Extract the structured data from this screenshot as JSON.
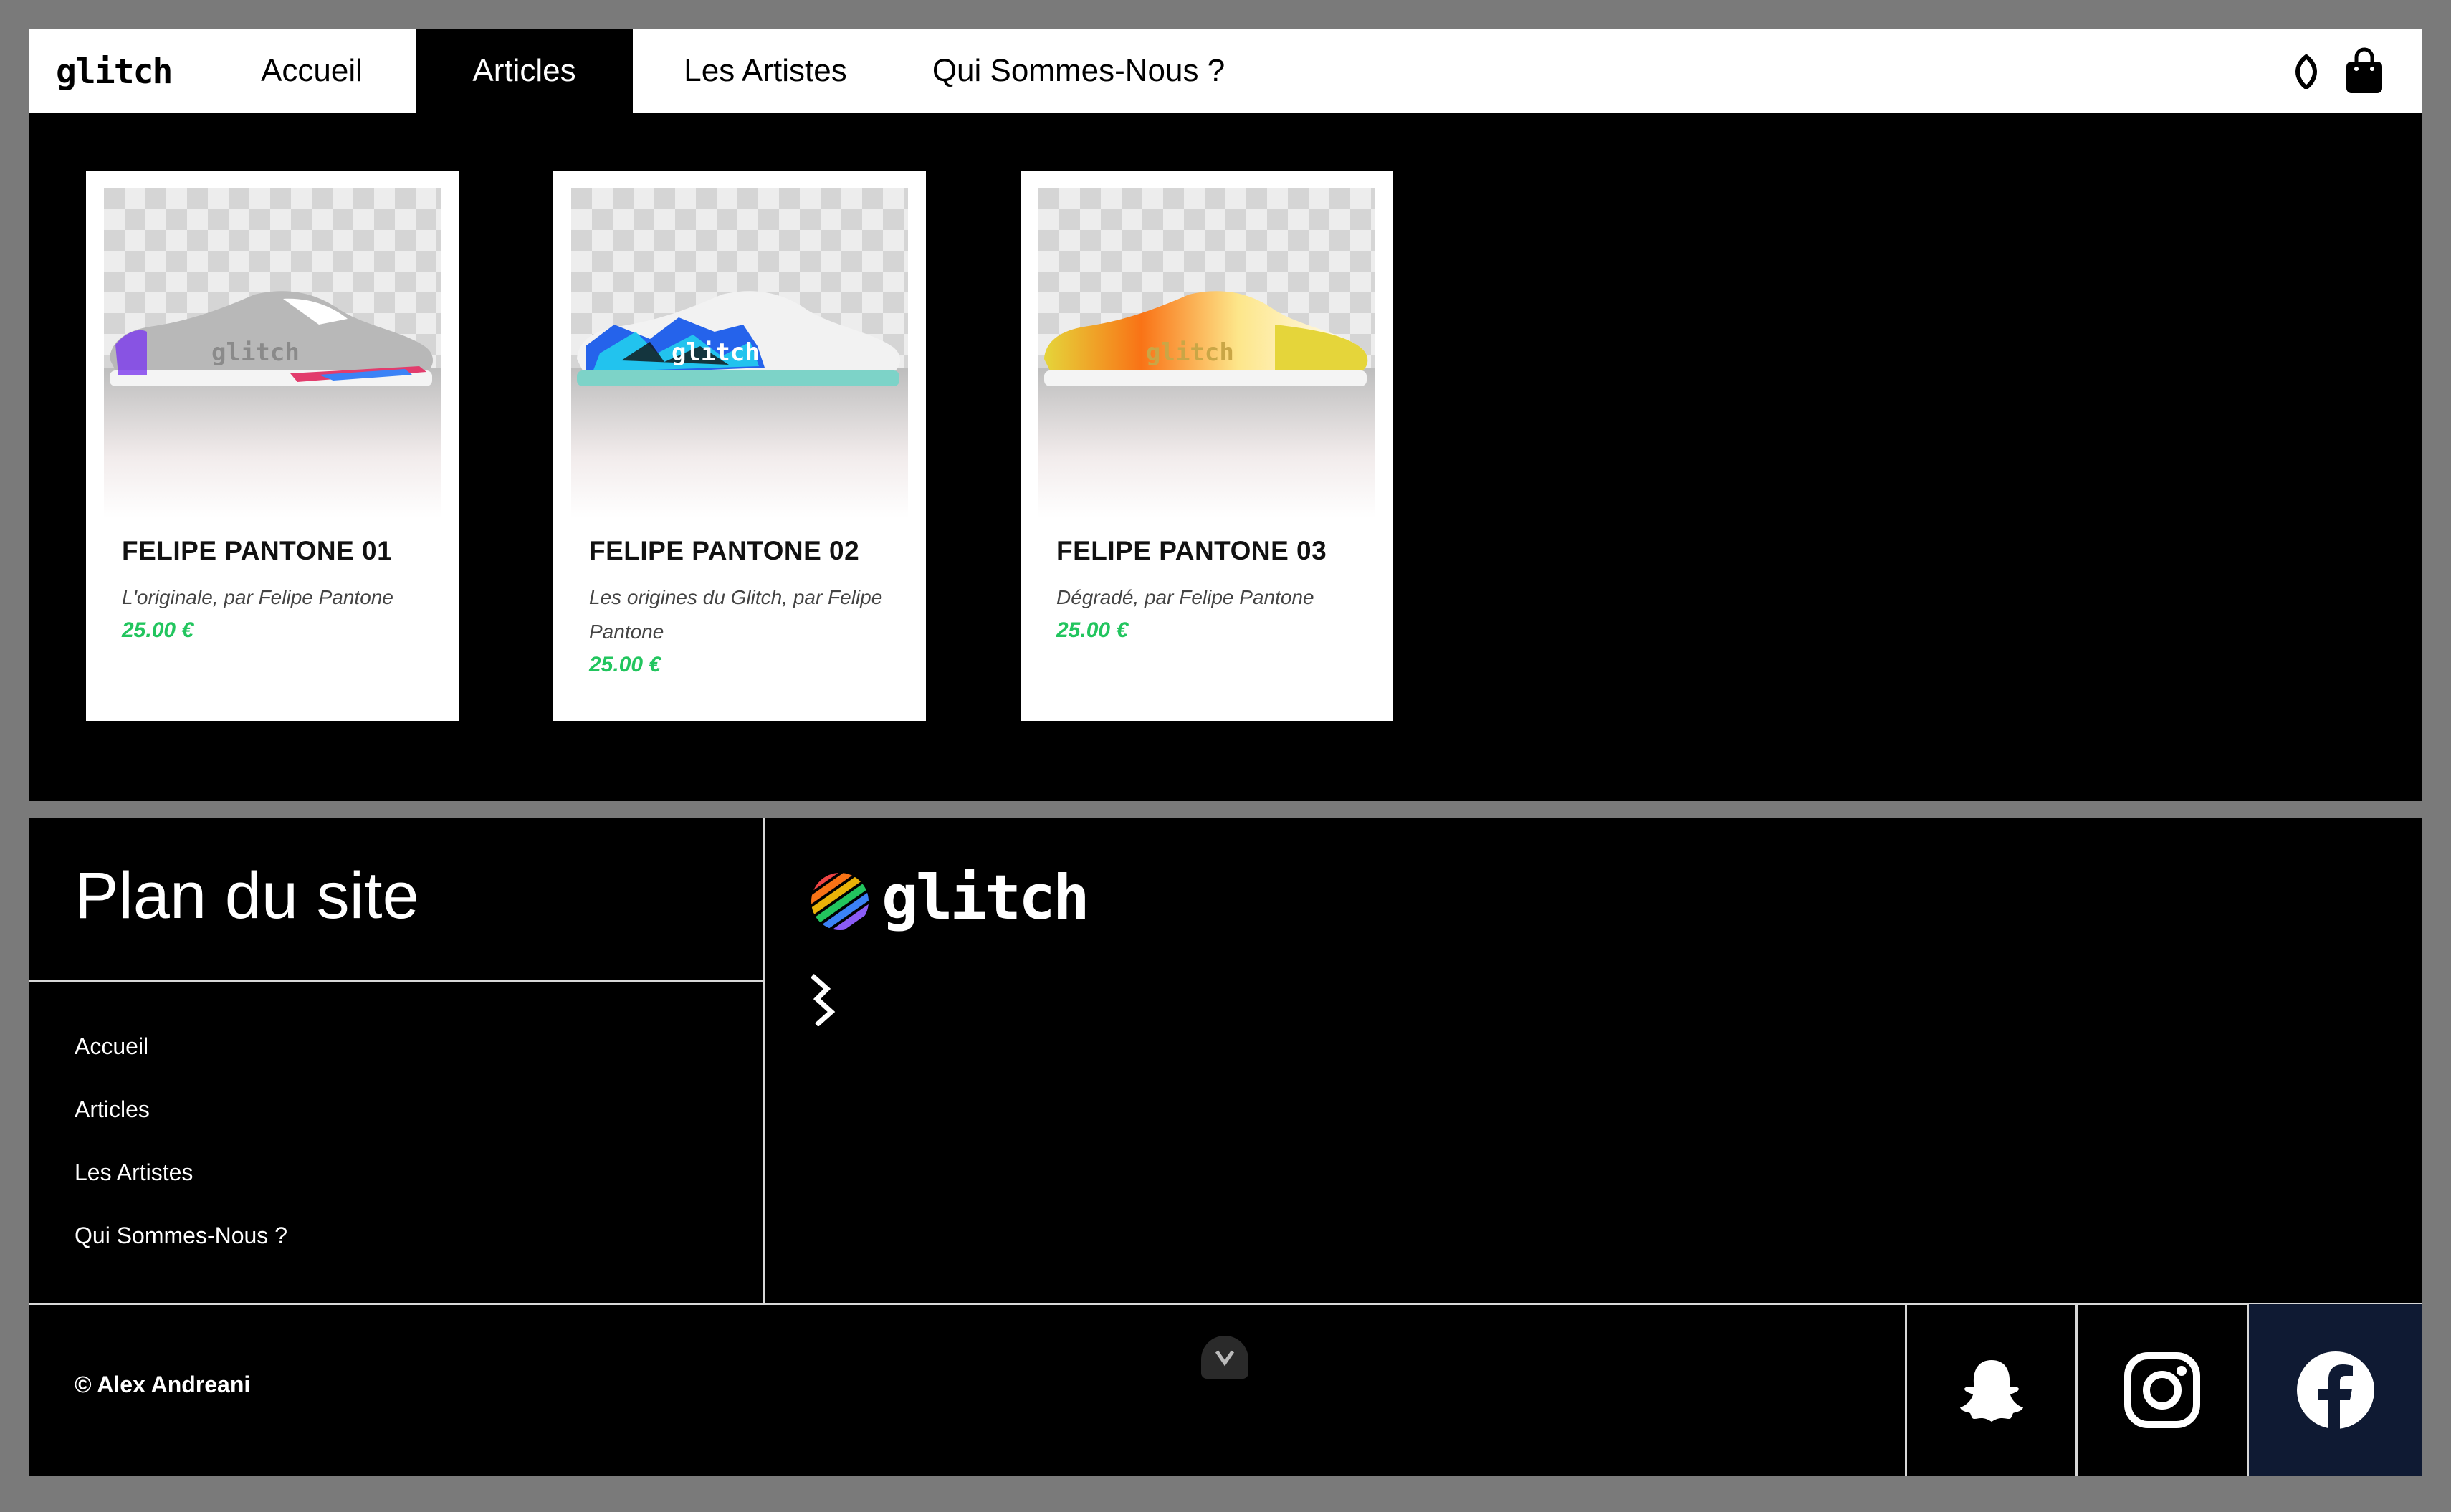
{
  "nav": {
    "logo": "glitch",
    "items": [
      {
        "label": "Accueil",
        "active": false
      },
      {
        "label": "Articles",
        "active": true
      },
      {
        "label": "Les Artistes",
        "active": false
      },
      {
        "label": "Qui Sommes-Nous ?",
        "active": false
      }
    ],
    "icons": [
      "map-pin-icon",
      "shopping-bag-icon"
    ]
  },
  "products": [
    {
      "name": "FELIPE PANTONE 01",
      "description": "L'originale, par Felipe Pantone",
      "price": "25.00 €",
      "shoe_colors": [
        "#b8b8b8",
        "#9a9a9a"
      ]
    },
    {
      "name": "FELIPE PANTONE 02",
      "description": "Les origines du Glitch, par Felipe Pantone",
      "price": "25.00 €",
      "shoe_colors": [
        "#2563eb",
        "#7dd3c8"
      ]
    },
    {
      "name": "FELIPE PANTONE 03",
      "description": "Dégradé, par Felipe Pantone",
      "price": "25.00 €",
      "shoe_colors": [
        "#f97316",
        "#e5d53a"
      ]
    }
  ],
  "footer": {
    "sitemap_title": "Plan du site",
    "sitemap_links": [
      "Accueil",
      "Articles",
      "Les Artistes",
      "Qui Sommes-Nous ?"
    ],
    "brand": "glitch",
    "copyright": "© Alex Andreani",
    "social": [
      {
        "name": "snapchat-icon",
        "bg": "#000000"
      },
      {
        "name": "instagram-icon",
        "bg": "#000000"
      },
      {
        "name": "facebook-icon",
        "bg": "#0f1a33"
      }
    ]
  },
  "colors": {
    "price": "#22c55e",
    "background": "#000000",
    "outer": "#7a7a7a"
  }
}
